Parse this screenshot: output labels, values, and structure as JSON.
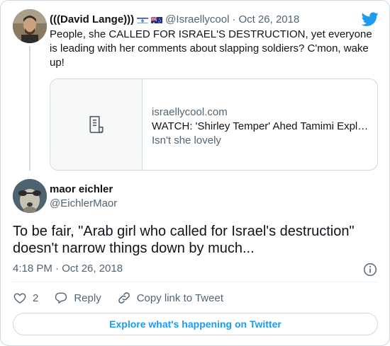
{
  "quoted_tweet": {
    "author_name": "(((David Lange)))",
    "handle": "@Israellycool",
    "separator": "·",
    "date": "Oct 26, 2018",
    "text": "People, she CALLED FOR ISRAEL'S DESTRUCTION, yet everyone is leading with her comments about slapping soldiers? C'mon, wake up!",
    "link_card": {
      "domain": "israellycool.com",
      "title": "WATCH: 'Shirley Temper' Ahed Tamimi Expl…",
      "description": "Isn't she lovely"
    }
  },
  "main_tweet": {
    "author_name": "maor eichler",
    "handle": "@EichlerMaor",
    "text": "To be fair, \"Arab girl who called for Israel's destruction\" doesn't narrow things down by much...",
    "timestamp": "4:18 PM · Oct 26, 2018"
  },
  "actions": {
    "like_count": "2",
    "reply_label": "Reply",
    "copy_link_label": "Copy link to Tweet"
  },
  "explore_label": "Explore what's happening on Twitter",
  "colors": {
    "accent": "#1d9bf0",
    "text": "#0f1419",
    "muted": "#536471",
    "border": "#cfd9de"
  },
  "icons": [
    "twitter-bird-icon",
    "israel-flag-icon",
    "australia-flag-icon",
    "document-icon",
    "info-icon",
    "heart-icon",
    "reply-icon",
    "link-icon"
  ]
}
